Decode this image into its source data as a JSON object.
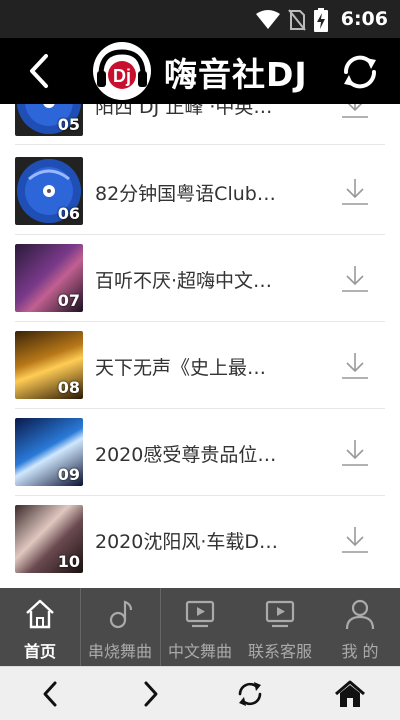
{
  "status_bar": {
    "time": "6:06"
  },
  "header": {
    "title": "嗨音社DJ",
    "logo_text": "Dj"
  },
  "list": {
    "items": [
      {
        "num": "05",
        "title": "阳西 DJ 正峰 ·中英…"
      },
      {
        "num": "06",
        "title": "82分钟国粤语Club…"
      },
      {
        "num": "07",
        "title": "百听不厌·超嗨中文…"
      },
      {
        "num": "08",
        "title": "天下无声《史上最…"
      },
      {
        "num": "09",
        "title": "2020感受尊贵品位…"
      },
      {
        "num": "10",
        "title": "2020沈阳风·车载D…"
      }
    ]
  },
  "tabs": [
    {
      "label": "首页",
      "icon": "home-icon",
      "active": true
    },
    {
      "label": "串烧舞曲",
      "icon": "music-note-icon",
      "active": false
    },
    {
      "label": "中文舞曲",
      "icon": "video-icon",
      "active": false
    },
    {
      "label": "联系客服",
      "icon": "video-icon",
      "active": false
    },
    {
      "label": "我 的",
      "icon": "user-icon",
      "active": false
    }
  ],
  "colors": {
    "status_bar": "#222222",
    "title_bar": "#000000",
    "tab_bar": "#4a4a4a",
    "nav_bar": "#efefef"
  }
}
